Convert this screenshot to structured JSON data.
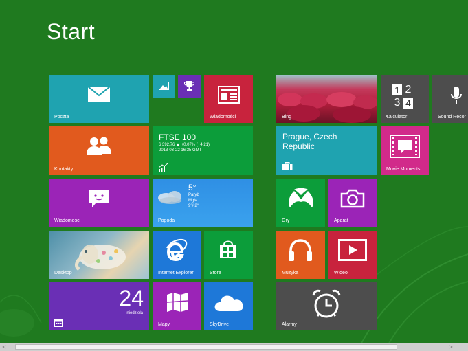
{
  "title": "Start",
  "tiles": {
    "poczta": {
      "label": "Poczta",
      "color": "#1fa3b0"
    },
    "photos": {
      "label": "",
      "color": "#1fa3b0"
    },
    "trophy": {
      "label": "",
      "color": "#6a2fb5"
    },
    "wiadomosci_news": {
      "label": "Wiadomości",
      "color": "#c8233d"
    },
    "kontakty": {
      "label": "Kontakty",
      "color": "#e15a1e"
    },
    "finance": {
      "title": "FTSE 100",
      "line1": "6 392,76 ▲ +0,07% (+4,21)",
      "line2": "2013-03-22 16:35 GMT",
      "color": "#0c9d3a"
    },
    "wiadomosci_msg": {
      "label": "Wiadomości",
      "color": "#9b24b7"
    },
    "pogoda": {
      "label": "Pogoda",
      "temp": "5°",
      "city": "Paryż",
      "cond": "Mgła",
      "range": "9°/-2°",
      "color": "#2d8ee6"
    },
    "desktop": {
      "label": "Desktop",
      "color": "#6aa0b8"
    },
    "ie": {
      "label": "Internet Explorer",
      "color": "#1e78d8"
    },
    "store": {
      "label": "Store",
      "color": "#0c9d3a"
    },
    "calendar": {
      "day": "24",
      "weekday": "niedziela",
      "color": "#6a2fb5"
    },
    "mapy": {
      "label": "Mapy",
      "color": "#9b24b7"
    },
    "skydrive": {
      "label": "SkyDrive",
      "color": "#1e78d8"
    },
    "bing": {
      "label": "Bing",
      "color": "#b01d3b"
    },
    "calculator": {
      "label": "€alculator",
      "digits": [
        "1",
        "2",
        "3",
        "4"
      ],
      "color": "#4d4d4d"
    },
    "sound_recorder": {
      "label": "Sound Recor",
      "color": "#4d4d4d"
    },
    "travel": {
      "title": "Prague, Czech Republic",
      "color": "#1fa3b0"
    },
    "movie_moments": {
      "label": "Movie Moments",
      "color": "#d12a8a"
    },
    "gry": {
      "label": "Gry",
      "color": "#0c9d3a"
    },
    "aparat": {
      "label": "Aparat",
      "color": "#9b24b7"
    },
    "muzyka": {
      "label": "Muzyka",
      "color": "#e15a1e"
    },
    "wideo": {
      "label": "Wideo",
      "color": "#c8233d"
    },
    "alarmy": {
      "label": "Alarmy",
      "color": "#4d4d4d"
    }
  },
  "scroll": {
    "left_arrow": "<",
    "right_arrow": ">"
  }
}
